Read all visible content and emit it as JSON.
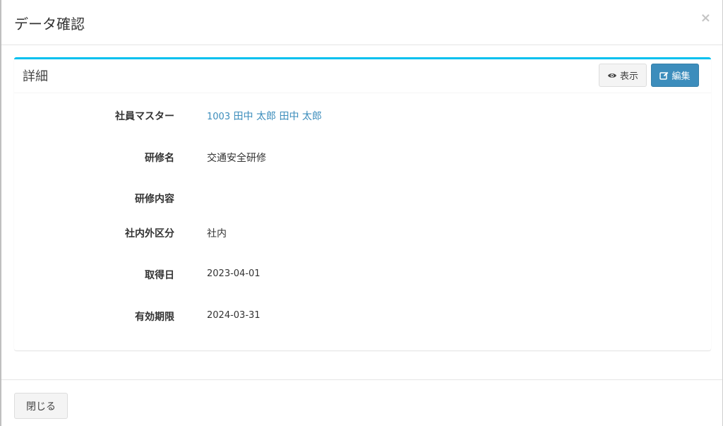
{
  "modal": {
    "title": "データ確認",
    "close_symbol": "×"
  },
  "box": {
    "title": "詳細",
    "buttons": {
      "view": {
        "label": "表示",
        "icon": "eye-icon"
      },
      "edit": {
        "label": "編集",
        "icon": "edit-icon"
      }
    }
  },
  "fields": [
    {
      "label": "社員マスター",
      "code": "1003",
      "value": "田中 太郎 田中 太郎"
    },
    {
      "label": "研修名",
      "value": "交通安全研修"
    },
    {
      "label": "研修内容",
      "value": ""
    },
    {
      "label": "社内外区分",
      "value": "社内"
    },
    {
      "label": "取得日",
      "value": "2023-04-01"
    },
    {
      "label": "有効期限",
      "value": "2024-03-31"
    }
  ],
  "footer": {
    "close_label": "閉じる"
  },
  "colors": {
    "accent_border": "#00c0ef",
    "primary_button": "#3c8dbc",
    "link": "#3c8dbc"
  }
}
